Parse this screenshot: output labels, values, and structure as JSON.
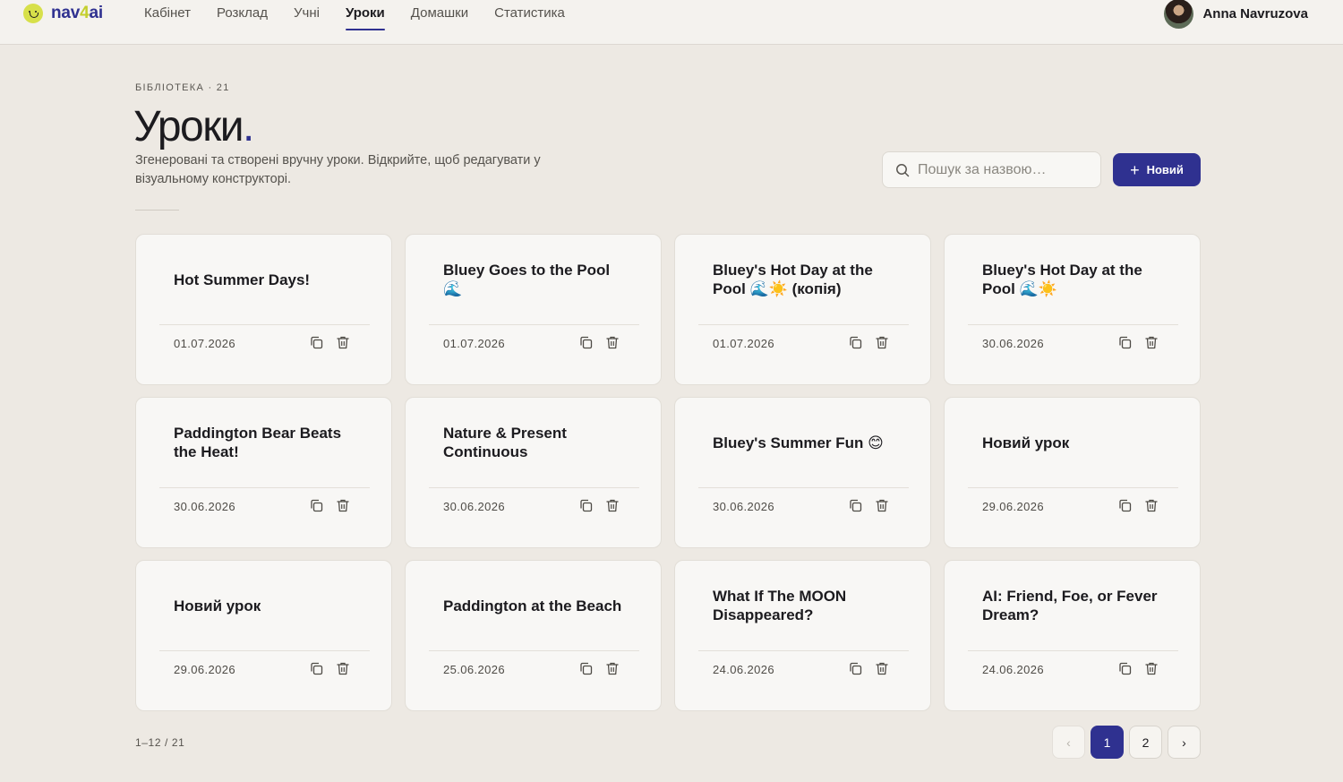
{
  "brand": {
    "name_pre": "nav",
    "name_four": "4",
    "name_post": "ai"
  },
  "nav": {
    "items": [
      {
        "label": "Кабінет"
      },
      {
        "label": "Розклад"
      },
      {
        "label": "Учні"
      },
      {
        "label": "Уроки"
      },
      {
        "label": "Домашки"
      },
      {
        "label": "Статистика"
      }
    ],
    "active": "Уроки"
  },
  "user": {
    "name": "Anna Navruzova"
  },
  "page": {
    "eyebrow": "БІБЛІОТЕКА · 21",
    "title": "Уроки",
    "title_dot": ".",
    "subtitle": "Згенеровані та створені вручну уроки. Відкрийте, щоб редагувати у візуальному конструкторі."
  },
  "search": {
    "placeholder": "Пошук за назвою…",
    "value": ""
  },
  "new_button": {
    "plus": "+",
    "label": "Новий"
  },
  "lessons": [
    {
      "title": "Hot Summer Days!",
      "date": "01.07.2026"
    },
    {
      "title": "Bluey Goes to the Pool 🌊",
      "date": "01.07.2026"
    },
    {
      "title": "Bluey's Hot Day at the Pool 🌊☀️ (копія)",
      "date": "01.07.2026"
    },
    {
      "title": "Bluey's Hot Day at the Pool 🌊☀️",
      "date": "30.06.2026"
    },
    {
      "title": "Paddington Bear Beats the Heat!",
      "date": "30.06.2026"
    },
    {
      "title": "Nature & Present Continuous",
      "date": "30.06.2026"
    },
    {
      "title": "Bluey's Summer Fun 😊",
      "date": "30.06.2026"
    },
    {
      "title": "Новий урок",
      "date": "29.06.2026"
    },
    {
      "title": "Новий урок",
      "date": "29.06.2026"
    },
    {
      "title": "Paddington at the Beach",
      "date": "25.06.2026"
    },
    {
      "title": "What If The MOON Disappeared?",
      "date": "24.06.2026"
    },
    {
      "title": "AI: Friend, Foe, or Fever Dream?",
      "date": "24.06.2026"
    }
  ],
  "pagination": {
    "range": "1–12  /  21",
    "prev": "‹",
    "next": "›",
    "pages": [
      "1",
      "2"
    ],
    "current": "1"
  },
  "colors": {
    "accent": "#2f3190",
    "brand_lime": "#d7e04a",
    "background": "#ede9e3",
    "card": "#f8f7f5"
  },
  "icons": {
    "copy": "copy-icon",
    "delete": "trash-icon",
    "search": "search-icon",
    "plus": "plus-icon"
  }
}
